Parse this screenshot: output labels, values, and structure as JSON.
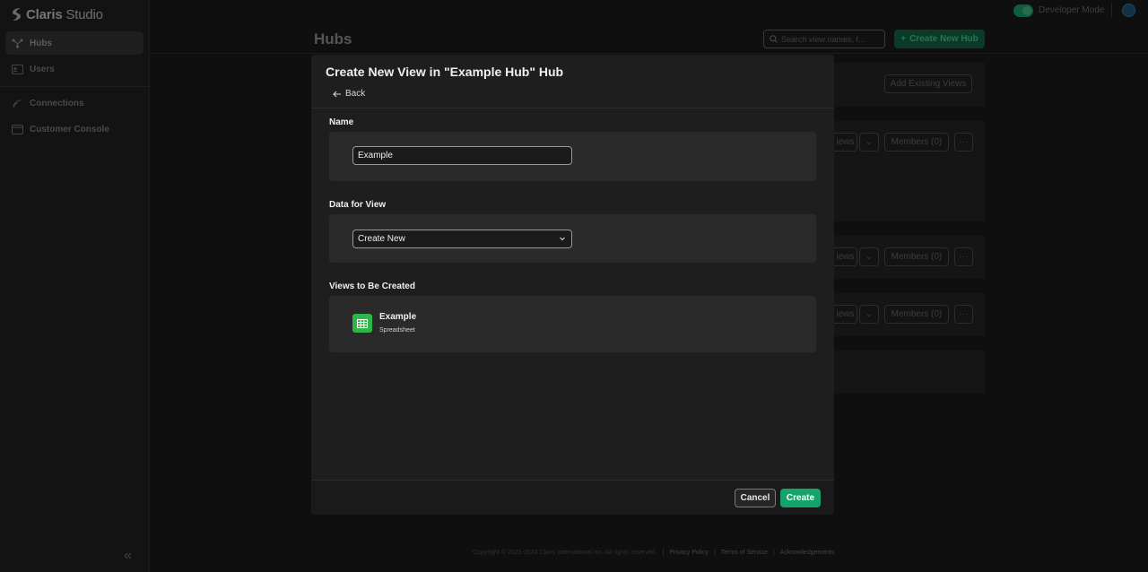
{
  "app": {
    "logo_brand": "Claris",
    "logo_product": "Studio"
  },
  "sidebar": {
    "items": [
      {
        "label": "Hubs",
        "icon": "hubs-icon",
        "active": true
      },
      {
        "label": "Users",
        "icon": "users-icon",
        "active": false
      },
      {
        "label": "Connections",
        "icon": "connections-icon",
        "active": false
      },
      {
        "label": "Customer Console",
        "icon": "console-icon",
        "active": false
      }
    ]
  },
  "topbar": {
    "developer_mode_label": "Developer Mode",
    "developer_mode_on": true
  },
  "page": {
    "title": "Hubs",
    "search_placeholder": "Search view names, f...",
    "new_hub_label": "Create New Hub",
    "add_existing_views_label": "Add Existing Views",
    "views_label_partial": "iews",
    "members_label": "Members (0)",
    "more_label": "···"
  },
  "footer": {
    "copyright": "Copyright © 2022-2024 Claris International Inc. All rights reserved.",
    "links": [
      "Privacy Policy",
      "Terms of Service",
      "Acknowledgements"
    ]
  },
  "modal": {
    "title": "Create New View in \"Example Hub\" Hub",
    "back_label": "Back",
    "name_section": {
      "label": "Name",
      "value": "Example"
    },
    "data_section": {
      "label": "Data for View",
      "selected": "Create New"
    },
    "views_section": {
      "label": "Views to Be Created",
      "items": [
        {
          "name": "Example",
          "type": "Spreadsheet",
          "icon": "spreadsheet-icon"
        }
      ]
    },
    "cancel_label": "Cancel",
    "create_label": "Create"
  },
  "colors": {
    "accent": "#14a36b",
    "spreadsheet_icon": "#2fb54b"
  }
}
